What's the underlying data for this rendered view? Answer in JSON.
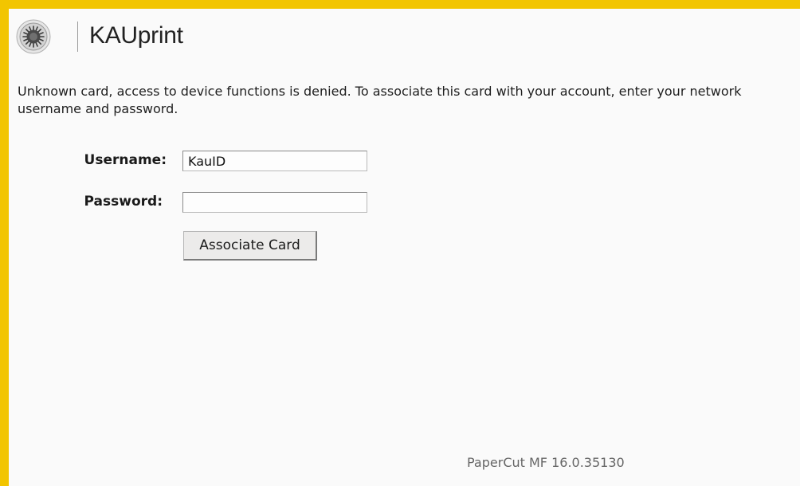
{
  "header": {
    "app_title": "KAUprint",
    "logo_icon": "university-seal-icon"
  },
  "message": "Unknown card, access to device functions is denied. To associate this card with your account, enter your network username and password.",
  "form": {
    "username_label": "Username:",
    "username_value": "KauID",
    "password_label": "Password:",
    "password_value": "",
    "submit_label": "Associate Card"
  },
  "footer": {
    "version": "PaperCut MF 16.0.35130"
  },
  "colors": {
    "border_accent": "#f2c500",
    "background": "#fafafa",
    "text": "#1e1e1e",
    "muted_text": "#666666"
  }
}
